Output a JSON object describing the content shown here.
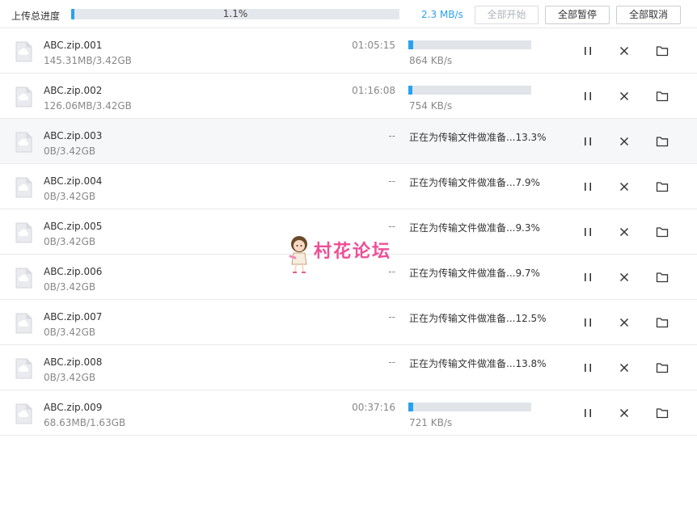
{
  "header": {
    "label": "上传总进度",
    "total_percent_text": "1.1%",
    "total_progress": 0.011,
    "total_speed": "2.3 MB/s",
    "start_all_label": "全部开始",
    "pause_all_label": "全部暂停",
    "cancel_all_label": "全部取消"
  },
  "rows": [
    {
      "name": "ABC.zip.001",
      "size": "145.31MB/3.42GB",
      "eta": "01:05:15",
      "status": "transfer",
      "progress": 0.042,
      "speed": "864 KB/s",
      "highlighted": false
    },
    {
      "name": "ABC.zip.002",
      "size": "126.06MB/3.42GB",
      "eta": "01:16:08",
      "status": "transfer",
      "progress": 0.036,
      "speed": "754 KB/s",
      "highlighted": false
    },
    {
      "name": "ABC.zip.003",
      "size": "0B/3.42GB",
      "eta": "--",
      "status": "preparing",
      "prep_text": "正在为传输文件做准备...13.3%",
      "highlighted": true
    },
    {
      "name": "ABC.zip.004",
      "size": "0B/3.42GB",
      "eta": "--",
      "status": "preparing",
      "prep_text": "正在为传输文件做准备...7.9%",
      "highlighted": false
    },
    {
      "name": "ABC.zip.005",
      "size": "0B/3.42GB",
      "eta": "--",
      "status": "preparing",
      "prep_text": "正在为传输文件做准备...9.3%",
      "highlighted": false
    },
    {
      "name": "ABC.zip.006",
      "size": "0B/3.42GB",
      "eta": "--",
      "status": "preparing",
      "prep_text": "正在为传输文件做准备...9.7%",
      "highlighted": false
    },
    {
      "name": "ABC.zip.007",
      "size": "0B/3.42GB",
      "eta": "--",
      "status": "preparing",
      "prep_text": "正在为传输文件做准备...12.5%",
      "highlighted": false
    },
    {
      "name": "ABC.zip.008",
      "size": "0B/3.42GB",
      "eta": "--",
      "status": "preparing",
      "prep_text": "正在为传输文件做准备...13.8%",
      "highlighted": false
    },
    {
      "name": "ABC.zip.009",
      "size": "68.63MB/1.63GB",
      "eta": "00:37:16",
      "status": "transfer",
      "progress": 0.04,
      "speed": "721 KB/s",
      "highlighted": false
    }
  ],
  "icons": {
    "file": "cloud-file-icon",
    "pause": "pause-icon",
    "close": "close-icon",
    "folder": "folder-icon"
  },
  "watermark": {
    "text": "村花论坛"
  },
  "colors": {
    "accent": "#2aa1f0",
    "track": "#e1e4e9",
    "watermark": "#ee4f97"
  }
}
